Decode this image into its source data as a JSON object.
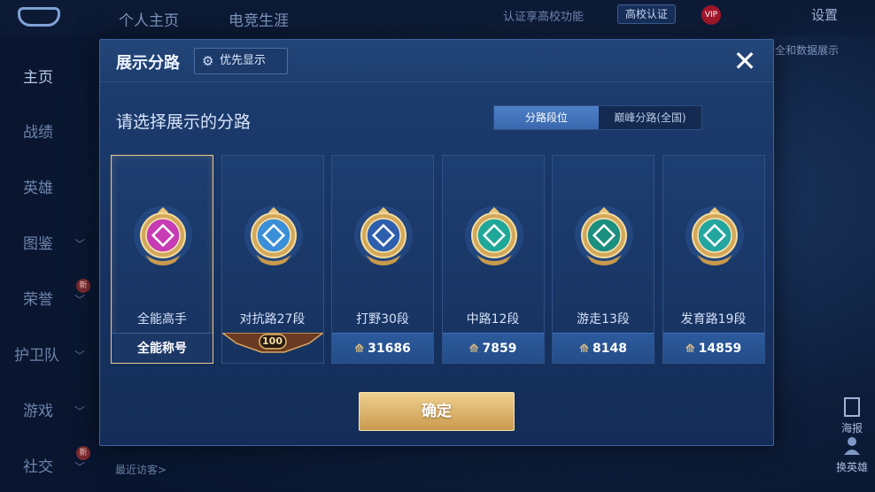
{
  "top_bar": {
    "tabs": [
      "个人主页",
      "电竞生涯"
    ],
    "note": "认证享高校功能",
    "cert_badge": "高校认证",
    "vip_badge": "VIP",
    "settings": "设置"
  },
  "sidebar": {
    "items": [
      {
        "label": "主页",
        "active": true,
        "chevron": false
      },
      {
        "label": "战绩",
        "active": false,
        "chevron": false
      },
      {
        "label": "英雄",
        "active": false,
        "chevron": false
      },
      {
        "label": "图鉴",
        "active": false,
        "chevron": true
      },
      {
        "label": "荣誉",
        "active": false,
        "chevron": true
      },
      {
        "label": "护卫队",
        "active": false,
        "chevron": true
      },
      {
        "label": "游戏",
        "active": false,
        "chevron": true
      },
      {
        "label": "社交",
        "active": false,
        "chevron": true
      }
    ],
    "hot_tag": "新"
  },
  "right": {
    "note": "全和数据展示",
    "poster": "海报",
    "change_hero": "换英雄"
  },
  "visitors": "最近访客>",
  "modal": {
    "title": "展示分路",
    "priority_button": "优先显示",
    "close": "✕",
    "subtitle": "请选择展示的分路",
    "toggle": {
      "on": "分路段位",
      "off": "巅峰分路(全国)"
    },
    "confirm": "确定",
    "cards": [
      {
        "name": "全能高手",
        "footer": "全能称号",
        "footer_type": "text",
        "selected": true,
        "emblem_color": "#c73bb5"
      },
      {
        "name": "对抗路27段",
        "footer": "100",
        "footer_type": "rank",
        "selected": false,
        "emblem_color": "#3a8fd8"
      },
      {
        "name": "打野30段",
        "footer": "31686",
        "footer_type": "points",
        "selected": false,
        "emblem_color": "#2d5fae"
      },
      {
        "name": "中路12段",
        "footer": "7859",
        "footer_type": "points",
        "selected": false,
        "emblem_color": "#1fa89a"
      },
      {
        "name": "游走13段",
        "footer": "8148",
        "footer_type": "points",
        "selected": false,
        "emblem_color": "#1c8f7e"
      },
      {
        "name": "发育路19段",
        "footer": "14859",
        "footer_type": "points",
        "selected": false,
        "emblem_color": "#23a6a0"
      }
    ]
  }
}
